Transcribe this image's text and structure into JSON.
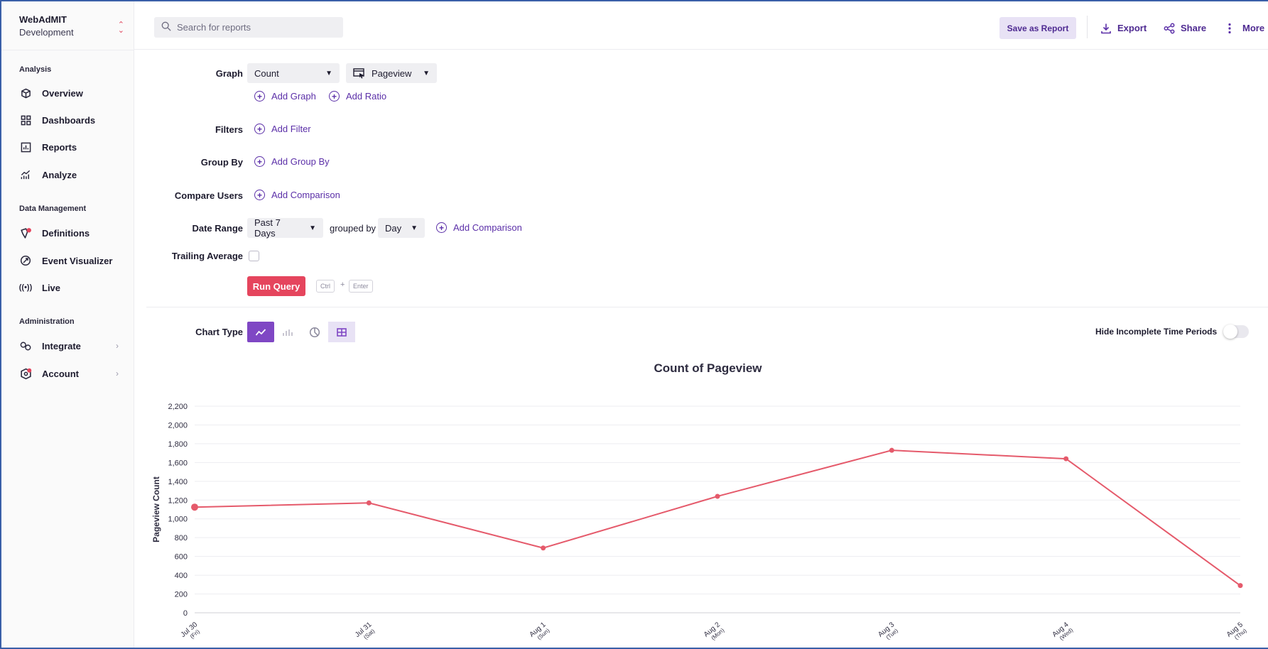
{
  "workspace": {
    "name": "WebAdMIT",
    "environment": "Development"
  },
  "sidebar": {
    "sections": [
      {
        "label": "Analysis"
      },
      {
        "label": "Data Management"
      },
      {
        "label": "Administration"
      }
    ],
    "items": [
      {
        "label": "Overview",
        "icon": "cube-icon"
      },
      {
        "label": "Dashboards",
        "icon": "grid-icon"
      },
      {
        "label": "Reports",
        "icon": "report-icon"
      },
      {
        "label": "Analyze",
        "icon": "analyze-icon"
      },
      {
        "label": "Definitions",
        "icon": "definitions-icon"
      },
      {
        "label": "Event Visualizer",
        "icon": "event-visualizer-icon"
      },
      {
        "label": "Live",
        "icon": "live-icon"
      },
      {
        "label": "Integrate",
        "icon": "integrate-icon"
      },
      {
        "label": "Account",
        "icon": "account-icon"
      }
    ]
  },
  "header": {
    "search_placeholder": "Search for reports",
    "save_label": "Save as Report",
    "export_label": "Export",
    "share_label": "Share",
    "more_label": "More"
  },
  "query": {
    "graph_label": "Graph",
    "graph_metric": "Count",
    "graph_event": "Pageview",
    "add_graph": "Add Graph",
    "add_ratio": "Add Ratio",
    "filters_label": "Filters",
    "add_filter": "Add Filter",
    "group_by_label": "Group By",
    "add_group_by": "Add Group By",
    "compare_users_label": "Compare Users",
    "add_comparison": "Add Comparison",
    "date_range_label": "Date Range",
    "date_range_value": "Past 7 Days",
    "grouped_by_text": "grouped by",
    "grouping_value": "Day",
    "add_date_comparison": "Add Comparison",
    "trailing_average_label": "Trailing Average",
    "run_label": "Run Query",
    "shortcut_key1": "Ctrl",
    "shortcut_plus": "+",
    "shortcut_key2": "Enter"
  },
  "chart_controls": {
    "chart_type_label": "Chart Type",
    "selected_type": "line",
    "hide_incomplete_label": "Hide Incomplete Time Periods",
    "hide_incomplete_on": false
  },
  "colors": {
    "accent": "#7f47c4",
    "link": "#5b2fa8",
    "run": "#e5455d",
    "series": "#e55a6b"
  },
  "chart_data": {
    "type": "line",
    "title": "Count of Pageview",
    "xlabel": "",
    "ylabel": "Pageview Count",
    "categories": [
      "Jul 30",
      "Jul 31",
      "Aug 1",
      "Aug 2",
      "Aug 3",
      "Aug 4",
      "Aug 5"
    ],
    "category_sub": [
      "(Fri)",
      "(Sat)",
      "(Sun)",
      "(Mon)",
      "(Tue)",
      "(Wed)",
      "(Thu)"
    ],
    "series": [
      {
        "values": [
          1125,
          1170,
          690,
          1240,
          1730,
          1640,
          290
        ]
      }
    ],
    "yticks": [
      "0",
      "200",
      "400",
      "600",
      "800",
      "1,000",
      "1,200",
      "1,400",
      "1,600",
      "1,800",
      "2,000",
      "2,200"
    ],
    "ylim": [
      0,
      2200
    ],
    "grid": true
  }
}
